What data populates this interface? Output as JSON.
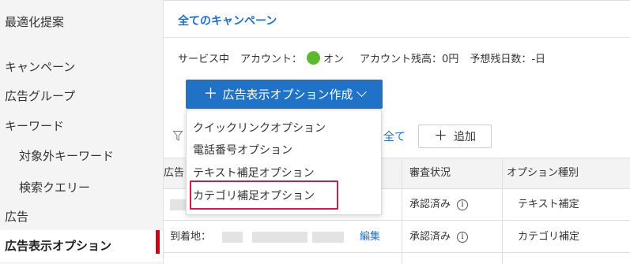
{
  "sidebar": {
    "items": [
      {
        "label": "最適化提案"
      },
      {
        "label": "キャンペーン"
      },
      {
        "label": "広告グループ"
      },
      {
        "label": "キーワード"
      },
      {
        "label": "対象外キーワード"
      },
      {
        "label": "検索クエリー"
      },
      {
        "label": "広告"
      },
      {
        "label": "広告表示オプション"
      }
    ]
  },
  "header": {
    "campaign_link": "全てのキャンペーン",
    "status": {
      "service": "サービス中",
      "account_label": "アカウント：",
      "account_state": "オン",
      "balance": "アカウント残高：0円",
      "days_left": "予想残日数：-日",
      "status_color": "#5cb82e"
    }
  },
  "create_button": {
    "plus": "＋",
    "label": "広告表示オプション作成"
  },
  "dropdown": {
    "items": [
      {
        "label": "クイックリンクオプション"
      },
      {
        "label": "電話番号オプション"
      },
      {
        "label": "テキスト補足オプション"
      },
      {
        "label": "カテゴリ補足オプション"
      }
    ],
    "highlight_color": "#c8204a"
  },
  "toolbar": {
    "filter_icon": "filter-icon",
    "all_label": "全て",
    "add_plus": "＋",
    "add_label": "追加"
  },
  "table": {
    "columns": [
      "広告",
      "審査状況",
      "オプション種別"
    ],
    "rows": [
      {
        "content": "",
        "edit": "",
        "review": "承認済み",
        "info": "i",
        "type": "テキスト補定"
      },
      {
        "content": "到着地：",
        "edit": "編集",
        "review": "承認済み",
        "info": "i",
        "type": "カテゴリ補定"
      }
    ]
  },
  "colors": {
    "accent": "#1f72c6",
    "link": "#1f6fc5",
    "active_marker": "#d0021b"
  }
}
